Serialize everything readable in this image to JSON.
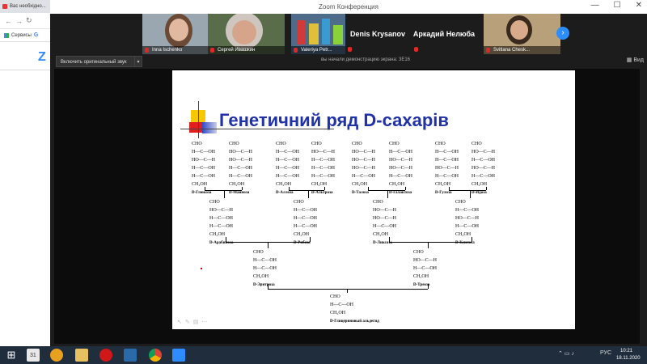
{
  "browser": {
    "tab_title": "Вас необхідно...",
    "bookmarks_label": "Сервисы"
  },
  "zoom": {
    "window_title": "Zoom Конференция",
    "participants": [
      {
        "name": "Inna Ischenko"
      },
      {
        "name": "Сергей Ивашкин"
      },
      {
        "name": "Valeriya Petr..."
      },
      {
        "name": "Denis Krysanov"
      },
      {
        "name": "Аркадий Нелюба"
      },
      {
        "name": "Svitlana Chesk..."
      }
    ],
    "share_button": "Включить оригинальный звук",
    "sharing_text": "вы начали демонстрацию экрана: 3E16",
    "view_label": "Вид"
  },
  "slide": {
    "title": "Генетичний ряд D-сахарів",
    "hexoses": [
      {
        "rows": [
          "CHO",
          "H—C—OH",
          "HO—C—H",
          "H—C—OH",
          "H—C—OH",
          "CH₂OH"
        ],
        "name": "D-Глюкоза"
      },
      {
        "rows": [
          "CHO",
          "HO—C—H",
          "HO—C—H",
          "H—C—OH",
          "H—C—OH",
          "CH₂OH"
        ],
        "name": "D-Манноза"
      },
      {
        "rows": [
          "CHO",
          "H—C—OH",
          "H—C—OH",
          "H—C—OH",
          "H—C—OH",
          "CH₂OH"
        ],
        "name": "D-Аллоза"
      },
      {
        "rows": [
          "CHO",
          "HO—C—H",
          "H—C—OH",
          "H—C—OH",
          "H—C—OH",
          "CH₂OH"
        ],
        "name": "D-Альтроза"
      },
      {
        "rows": [
          "CHO",
          "HO—C—H",
          "HO—C—H",
          "HO—C—H",
          "H—C—OH",
          "CH₂OH"
        ],
        "name": "D-Талоза"
      },
      {
        "rows": [
          "CHO",
          "H—C—OH",
          "HO—C—H",
          "HO—C—H",
          "H—C—OH",
          "CH₂OH"
        ],
        "name": "D-Галактоза"
      },
      {
        "rows": [
          "CHO",
          "H—C—OH",
          "H—C—OH",
          "HO—C—H",
          "H—C—OH",
          "CH₂OH"
        ],
        "name": "D-Гулоза"
      },
      {
        "rows": [
          "CHO",
          "HO—C—H",
          "H—C—OH",
          "HO—C—H",
          "H—C—OH",
          "CH₂OH"
        ],
        "name": "D-Идоза"
      }
    ],
    "pentoses": [
      {
        "rows": [
          "CHO",
          "HO—C—H",
          "H—C—OH",
          "H—C—OH",
          "CH₂OH"
        ],
        "name": "D-Арабиноза"
      },
      {
        "rows": [
          "CHO",
          "H—C—OH",
          "H—C—OH",
          "H—C—OH",
          "CH₂OH"
        ],
        "name": "D-Рибоза"
      },
      {
        "rows": [
          "CHO",
          "HO—C—H",
          "HO—C—H",
          "H—C—OH",
          "CH₂OH"
        ],
        "name": "D-Ликсоза"
      },
      {
        "rows": [
          "CHO",
          "H—C—OH",
          "HO—C—H",
          "H—C—OH",
          "CH₂OH"
        ],
        "name": "D-Ксилоза"
      }
    ],
    "tetroses": [
      {
        "rows": [
          "CHO",
          "H—C—OH",
          "H—C—OH",
          "CH₂OH"
        ],
        "name": "D-Эритроза"
      },
      {
        "rows": [
          "CHO",
          "HO—C—H",
          "H—C—OH",
          "CH₂OH"
        ],
        "name": "D-Треоза"
      }
    ],
    "triose": {
      "rows": [
        "CHO",
        "H—C—OH",
        "CH₂OH"
      ],
      "name": "D-Глицериновый альдегид"
    }
  },
  "taskbar": {
    "calendar_num": "31",
    "lang": "РУС",
    "time": "10:21",
    "date": "18.11.2020"
  }
}
